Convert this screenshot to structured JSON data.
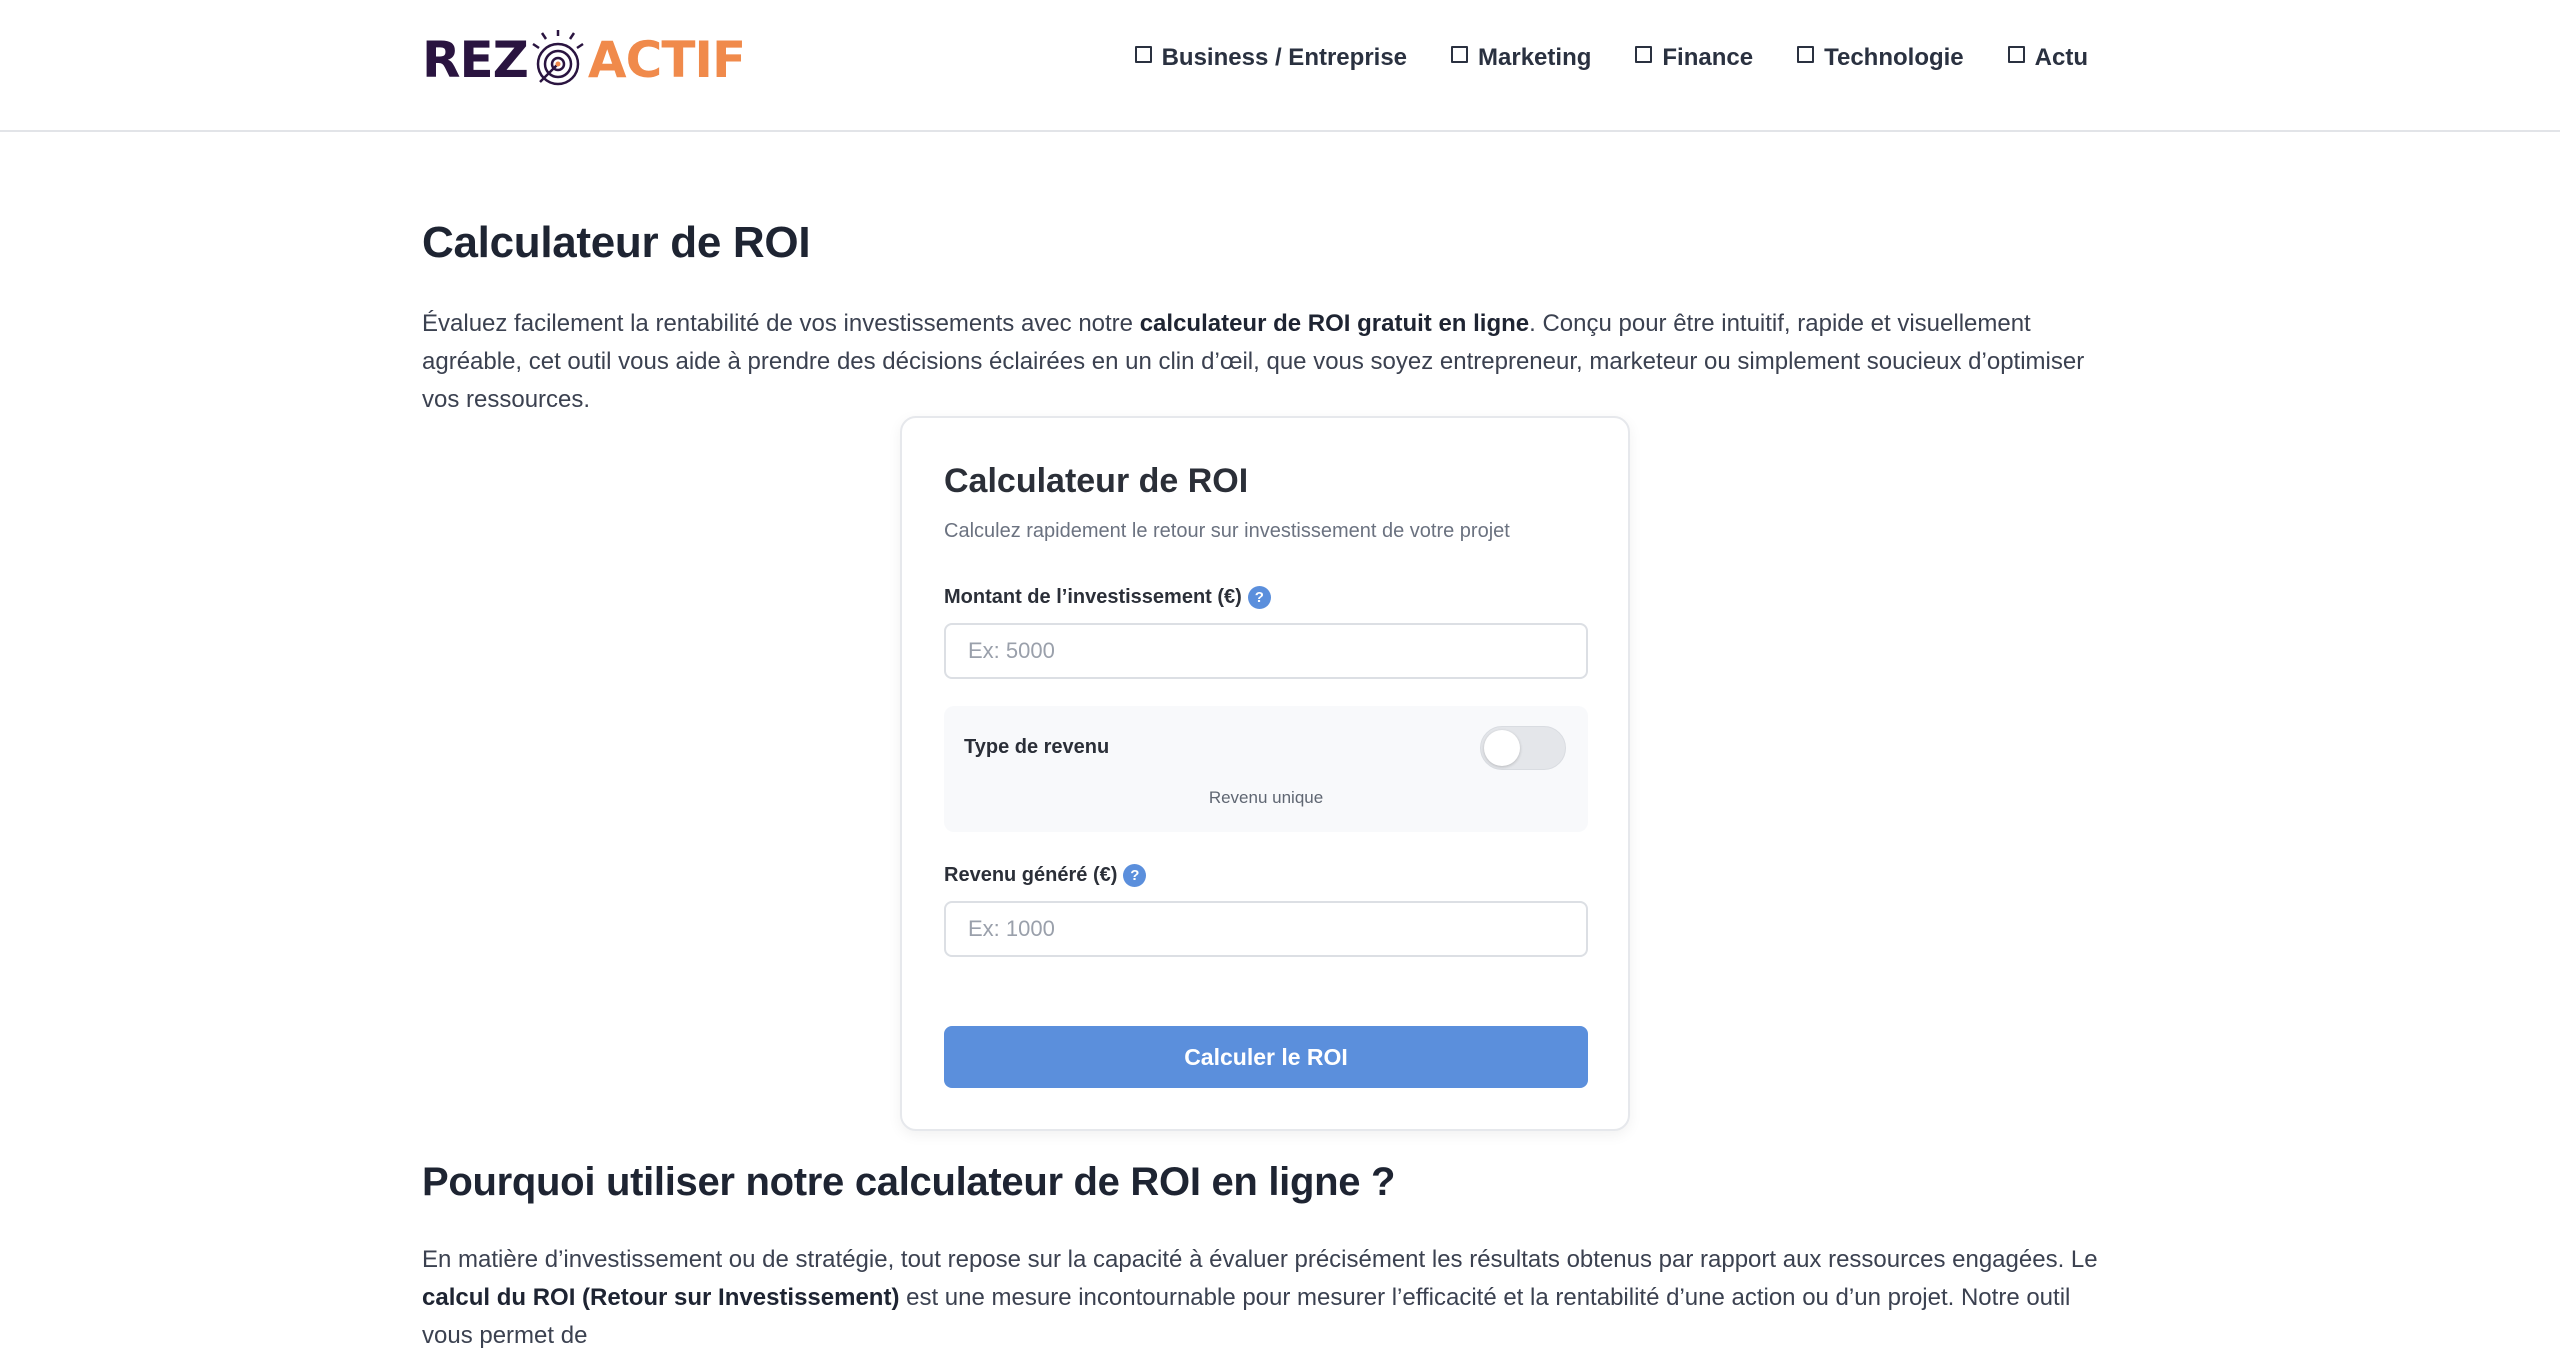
{
  "header": {
    "logo_left": "REZ",
    "logo_right": "ACTIF",
    "nav": [
      {
        "label": "Business / Entreprise"
      },
      {
        "label": "Marketing"
      },
      {
        "label": "Finance"
      },
      {
        "label": "Technologie"
      },
      {
        "label": "Actu"
      }
    ]
  },
  "main": {
    "title": "Calculateur de ROI",
    "intro": {
      "part1": "Évaluez facilement la rentabilité de vos investissements avec notre ",
      "bold": "calculateur de ROI gratuit en ligne",
      "part2": ". Conçu pour être intuitif, rapide et visuellement agréable, cet outil vous aide à prendre des décisions éclairées en un clin d’œil, que vous soyez entrepreneur, marketeur ou simplement soucieux d’optimiser vos ressources."
    }
  },
  "calculator": {
    "title": "Calculateur de ROI",
    "subtitle": "Calculez rapidement le retour sur investissement de votre projet",
    "investment": {
      "label": "Montant de l’investissement (€)",
      "placeholder": "Ex: 5000",
      "value": ""
    },
    "revenue_type": {
      "label": "Type de revenu",
      "state": "Revenu unique",
      "enabled": false
    },
    "revenue": {
      "label": "Revenu généré (€)",
      "placeholder": "Ex: 1000",
      "value": ""
    },
    "help_glyph": "?",
    "button_label": "Calculer le ROI"
  },
  "section": {
    "title": "Pourquoi utiliser notre calculateur de ROI en ligne ?",
    "text": {
      "part1": "En matière d’investissement ou de stratégie, tout repose sur la capacité à évaluer précisément les résultats obtenus par rapport aux ressources engagées. Le ",
      "bold": "calcul du ROI (Retour sur Investissement)",
      "part2": " est une mesure incontournable pour mesurer l’efficacité et la rentabilité d’une action ou d’un projet. Notre outil vous permet de"
    }
  },
  "colors": {
    "accent": "#5b8fdc",
    "logo_dark": "#2a1440",
    "logo_orange": "#f08a4b"
  }
}
